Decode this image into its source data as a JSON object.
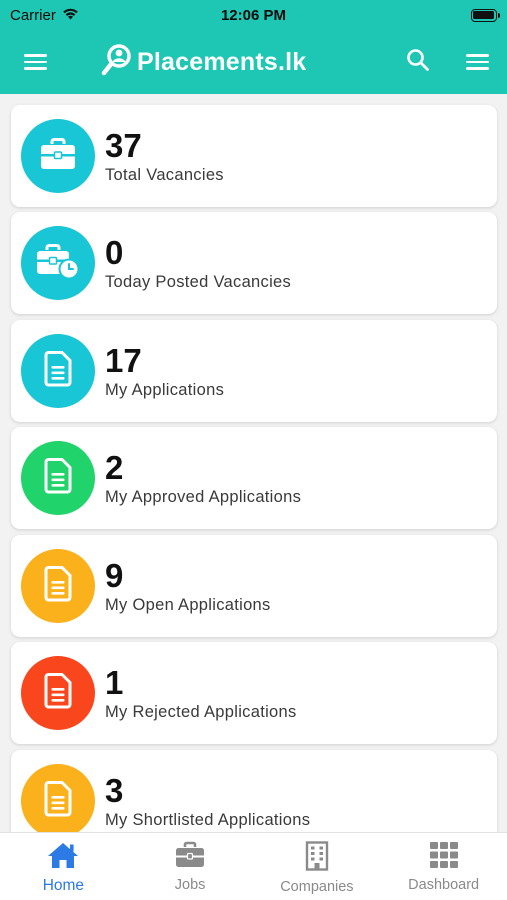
{
  "status_bar": {
    "carrier": "Carrier",
    "time": "12:06 PM"
  },
  "header": {
    "brand": "Placements.lk",
    "theme_color": "#1ec7b3"
  },
  "stats": [
    {
      "count": "37",
      "label": "Total Vacancies",
      "icon": "briefcase-icon",
      "color": "#19c6d6"
    },
    {
      "count": "0",
      "label": "Today Posted Vacancies",
      "icon": "briefcase-clock-icon",
      "color": "#19c6d6"
    },
    {
      "count": "17",
      "label": "My Applications",
      "icon": "document-icon",
      "color": "#19c6d6"
    },
    {
      "count": "2",
      "label": "My Approved Applications",
      "icon": "document-icon",
      "color": "#21d36b"
    },
    {
      "count": "9",
      "label": "My Open Applications",
      "icon": "document-icon",
      "color": "#fbb11b"
    },
    {
      "count": "1",
      "label": "My Rejected Applications",
      "icon": "document-icon",
      "color": "#f9461d"
    },
    {
      "count": "3",
      "label": "My Shortlisted Applications",
      "icon": "document-icon",
      "color": "#fbb11b"
    }
  ],
  "tabs": [
    {
      "label": "Home",
      "icon": "home-icon",
      "active": true
    },
    {
      "label": "Jobs",
      "icon": "briefcase-icon",
      "active": false
    },
    {
      "label": "Companies",
      "icon": "building-icon",
      "active": false
    },
    {
      "label": "Dashboard",
      "icon": "grid-icon",
      "active": false
    }
  ],
  "colors": {
    "active_tab": "#2c7be5",
    "inactive_tab": "#8a8a8a"
  }
}
